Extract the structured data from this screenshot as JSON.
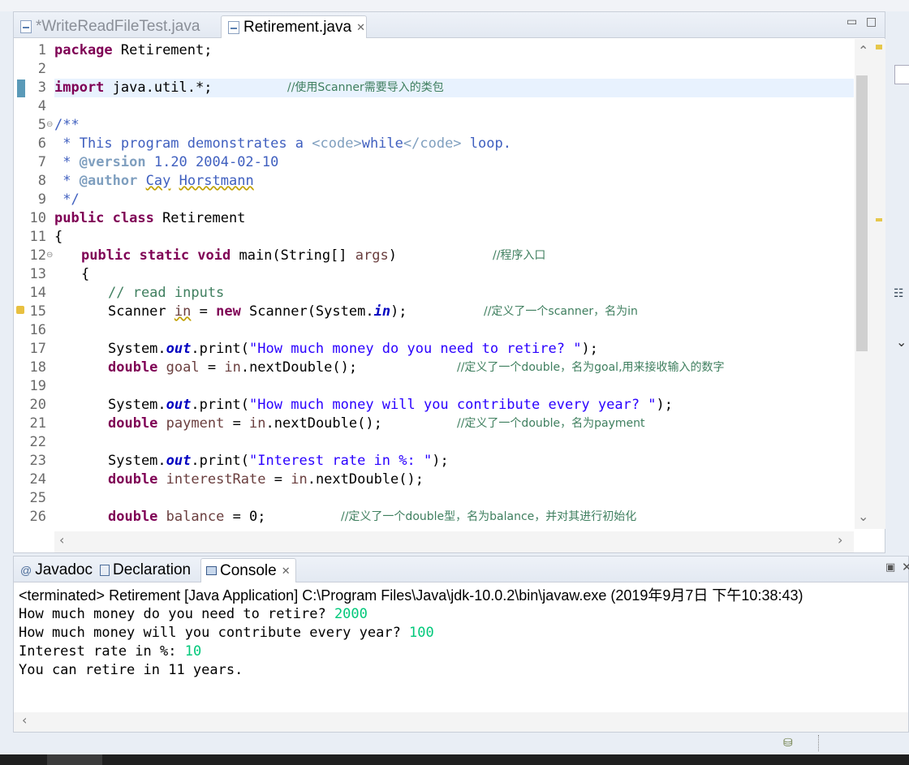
{
  "editor": {
    "tabs": [
      {
        "label": "*WriteReadFileTest.java"
      },
      {
        "label": "Retirement.java"
      }
    ],
    "lines": [
      "1",
      "2",
      "3",
      "4",
      "5",
      "6",
      "7",
      "8",
      "9",
      "10",
      "11",
      "12",
      "13",
      "14",
      "15",
      "16",
      "17",
      "18",
      "19",
      "20",
      "21",
      "22",
      "23",
      "24",
      "25",
      "26"
    ],
    "code": {
      "l1_kw": "package",
      "l1_rest": " Retirement;",
      "l3_kw": "import",
      "l3_rest": " java.util.*;",
      "l3_cm": "//使用Scanner需要导入的类包",
      "l5": "/**",
      "l6_a": " * This program demonstrates a ",
      "l6_b": "<code>",
      "l6_c": "while",
      "l6_d": "</code>",
      "l6_e": " loop.",
      "l7_a": " * ",
      "l7_b": "@version",
      "l7_c": " 1.20 2004-02-10",
      "l8_a": " * ",
      "l8_b": "@author",
      "l8_c": " ",
      "l8_d": "Cay",
      "l8_e": " ",
      "l8_f": "Horstmann",
      "l9": " */",
      "l10_kw": "public class",
      "l10_rest": " Retirement",
      "l11": "{",
      "l12_kw": "public static void",
      "l12_a": " main(String[] ",
      "l12_var": "args",
      "l12_b": ")",
      "l12_cm": "//程序入口",
      "l13": "{",
      "l14": "// read inputs",
      "l15_a": "Scanner ",
      "l15_var": "in",
      "l15_b": " = ",
      "l15_kw": "new",
      "l15_c": " Scanner(System.",
      "l15_fld": "in",
      "l15_d": ");",
      "l15_cm": "//定义了一个scanner，名为in",
      "l17_a": "System.",
      "l17_fld": "out",
      "l17_b": ".print(",
      "l17_str": "\"How much money do you need to retire? \"",
      "l17_c": ");",
      "l18_kw": "double",
      "l18_a": " ",
      "l18_var": "goal",
      "l18_b": " = ",
      "l18_var2": "in",
      "l18_c": ".nextDouble();",
      "l18_cm": "//定义了一个double，名为goal,用来接收输入的数字",
      "l20_a": "System.",
      "l20_fld": "out",
      "l20_b": ".print(",
      "l20_str": "\"How much money will you contribute every year? \"",
      "l20_c": ");",
      "l21_kw": "double",
      "l21_a": " ",
      "l21_var": "payment",
      "l21_b": " = ",
      "l21_var2": "in",
      "l21_c": ".nextDouble();",
      "l21_cm": "//定义了一个double，名为payment",
      "l23_a": "System.",
      "l23_fld": "out",
      "l23_b": ".print(",
      "l23_str": "\"Interest rate in %: \"",
      "l23_c": ");",
      "l24_kw": "double",
      "l24_a": " ",
      "l24_var": "interestRate",
      "l24_b": " = ",
      "l24_var2": "in",
      "l24_c": ".nextDouble();",
      "l26_kw": "double",
      "l26_a": " ",
      "l26_var": "balance",
      "l26_b": " = 0;",
      "l26_cm": "//定义了一个double型，名为balance，并对其进行初始化"
    }
  },
  "console": {
    "tabs": [
      {
        "label": "Javadoc",
        "icon": "@"
      },
      {
        "label": "Declaration",
        "icon": "declaration-icon"
      },
      {
        "label": "Console",
        "icon": "console-icon"
      }
    ],
    "header": "<terminated> Retirement [Java Application] C:\\Program Files\\Java\\jdk-10.0.2\\bin\\javaw.exe (2019年9月7日 下午10:38:43)",
    "output": [
      {
        "prompt": "How much money do you need to retire? ",
        "input": "2000"
      },
      {
        "prompt": "How much money will you contribute every year? ",
        "input": "100"
      },
      {
        "prompt": "Interest rate in %: ",
        "input": "10"
      },
      {
        "prompt": "You can retire in 11 years.",
        "input": ""
      }
    ],
    "input_color": "#00c87a"
  },
  "colors": {
    "keyword": "#7f0055",
    "string": "#2a00ff",
    "comment": "#3f7f5f",
    "javadoc": "#3f5fbf",
    "static_field": "#0000c0",
    "local_variable": "#6a3e3e"
  }
}
